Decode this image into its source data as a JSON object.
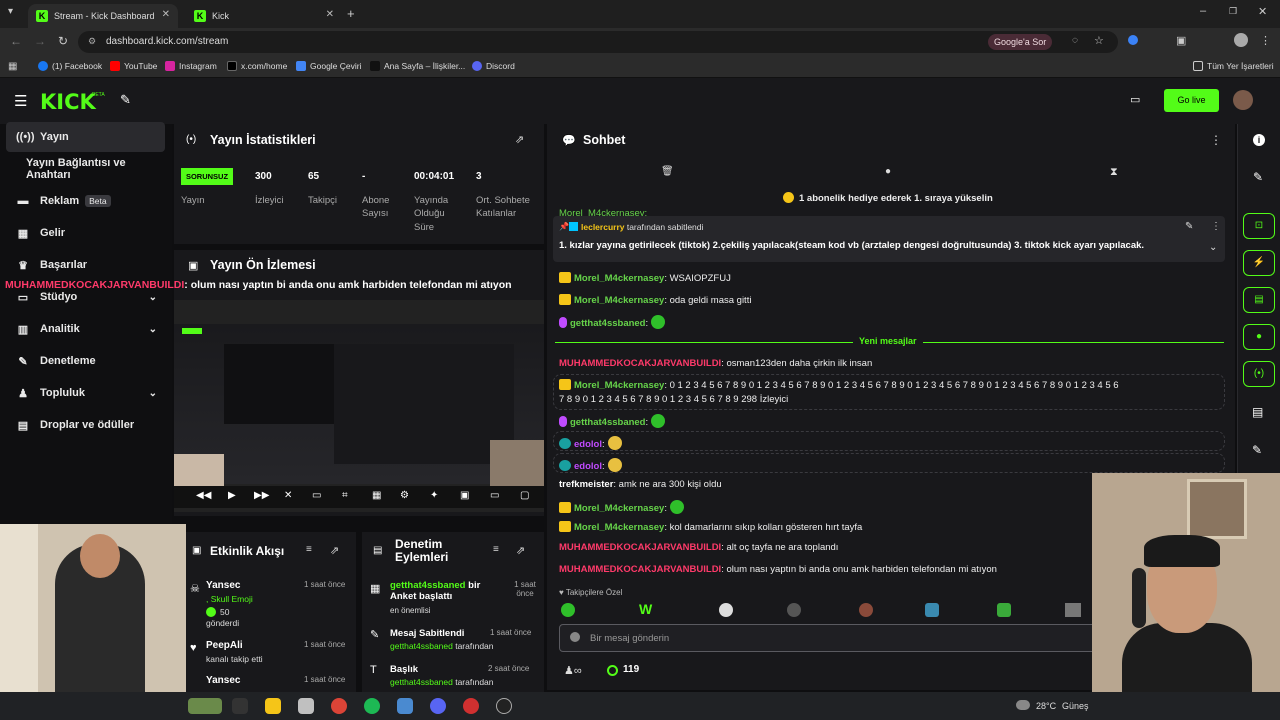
{
  "browser": {
    "tabs": [
      {
        "label": "Stream - Kick Dashboard",
        "active": true
      },
      {
        "label": "Kick",
        "active": false
      }
    ],
    "url": "dashboard.kick.com/stream",
    "google_sor": "Google'a Sor",
    "bookmarks": [
      "(1) Facebook",
      "YouTube",
      "Instagram",
      "x.com/home",
      "Google Çeviri",
      "Ana Sayfa – İlişkiler...",
      "Discord"
    ],
    "all_bookmarks": "Tüm Yer İşaretleri"
  },
  "kick": {
    "logo": "KICK",
    "logo_tag": "BETA",
    "go_live": "Go live"
  },
  "sidebar": {
    "items": [
      {
        "label": "Yayın"
      },
      {
        "label": "Yayın Bağlantısı ve Anahtarı"
      },
      {
        "label": "Reklam",
        "badge": "Beta"
      },
      {
        "label": "Gelir"
      },
      {
        "label": "Başarılar"
      },
      {
        "label": "Stüdyo"
      },
      {
        "label": "Analitik"
      },
      {
        "label": "Denetleme"
      },
      {
        "label": "Topluluk"
      },
      {
        "label": "Droplar ve ödüller"
      }
    ]
  },
  "overlay": {
    "user": "MUHAMMEDKOCAKJARVANBUILDI",
    "text": ": olum nası yaptın bi anda onu amk harbiden telefondan mi atıyon"
  },
  "stats": {
    "title": "Yayın İstatistikleri",
    "status": "SORUNSUZ",
    "items": [
      {
        "value": "",
        "label": "Yayın"
      },
      {
        "value": "300",
        "label": "İzleyici"
      },
      {
        "value": "65",
        "label": "Takipçi"
      },
      {
        "value": "-",
        "label": "Abone Sayısı"
      },
      {
        "value": "00:04:01",
        "label": "Yayında Olduğu Süre"
      },
      {
        "value": "3",
        "label": "Ort. Sohbete Katılanlar"
      }
    ]
  },
  "preview": {
    "title": "Yayın Ön İzlemesi"
  },
  "activity": {
    "title": "Etkinlik Akışı",
    "items": [
      {
        "user": "Yansec",
        "detail": ", Skull Emoji",
        "count": "50",
        "action": "gönderdi",
        "time": "1 saat önce"
      },
      {
        "user": "PeepAli",
        "detail": "kanalı takip etti",
        "time": "1 saat önce"
      },
      {
        "user": "Yansec",
        "detail": "",
        "time": "1 saat önce"
      }
    ]
  },
  "moderation": {
    "title": "Denetim Eylemleri",
    "items": [
      {
        "user": "getthat4ssbaned",
        "title": " bir Anket başlattı",
        "detail": "en önemlisi",
        "time": "1 saat önce"
      },
      {
        "user": "",
        "title": "Mesaj Sabitlendi",
        "detail_user": "getthat4ssbaned",
        "detail": " tarafından",
        "time": "1 saat önce"
      },
      {
        "user": "",
        "title": "Başlık",
        "detail_user": "getthat4ssbaned",
        "detail": " tarafından",
        "time": "2 saat önce"
      }
    ]
  },
  "chat": {
    "title": "Sohbet",
    "sub_banner": "1 abonelik hediye ederek 1. sıraya yükselin",
    "pinned_by_user": "leclercurry",
    "pinned_by_text": " tarafından sabitlendi",
    "pinned_text": "1. kızlar yayına getirilecek (tiktok) 2.çekiliş yapılacak(steam kod vb (arztalep dengesi doğrultusunda) 3. tiktok kick ayarı yapılacak.",
    "partial_msg": "Morel_M4ckernasey: ",
    "new_messages": "Yeni mesajlar",
    "messages": [
      {
        "user": "Morel_M4ckernasey",
        "text": ": WSAIOPZFUJ"
      },
      {
        "user": "Morel_M4ckernasey",
        "text": ": oda geldi masa gitti"
      },
      {
        "user": "getthat4ssbaned",
        "text": ":"
      },
      {
        "user": "MUHAMMEDKOCAKJARVANBUILDI",
        "text": ": osman123den daha çirkin ilk insan"
      },
      {
        "user": "Morel_M4ckernasey",
        "text": ": 0 1 2 3 4 5 6 7 8 9 0 1 2 3 4 5 6 7 8 9 0 1 2 3 4 5 6 7 8 9 0 1 2 3 4 5 6 7 8 9 0 1 2 3 4 5 6 7 8 9 0 1 2 3 4 5 6",
        "text2": "7 8 9 0 1 2 3 4 5 6 7 8 9 0 1 2 3 4 5 6 7 8 9 298 İzleyici"
      },
      {
        "user": "getthat4ssbaned",
        "text": ":"
      },
      {
        "user": "edolol",
        "text": ":"
      },
      {
        "user": "edolol",
        "text": ":"
      },
      {
        "user": "trefkmeister",
        "text": ": amk ne ara 300 kişi oldu"
      },
      {
        "user": "Morel_M4ckernasey",
        "text": ":"
      },
      {
        "user": "Morel_M4ckernasey",
        "text": ": kol damarlarını sıkıp kolları gösteren hırt tayfa"
      },
      {
        "user": "MUHAMMEDKOCAKJARVANBUILDI",
        "text": ": alt oç tayfa ne ara toplandı"
      },
      {
        "user": "MUHAMMEDKOCAKJARVANBUILDI",
        "text": ": olum nası yaptın bi anda onu amk harbiden telefondan mi atıyon"
      }
    ],
    "emote_bar_label": "Takipçilere Özel",
    "input_placeholder": "Bir mesaj gönderin",
    "points": "119"
  },
  "taskbar": {
    "weather": "28°C",
    "weather_text": "Güneş"
  },
  "colors": {
    "kick_green": "#53fc18",
    "mod_red": "#ff3a6a",
    "panel": "#18181b",
    "bg": "#0e0e10"
  }
}
